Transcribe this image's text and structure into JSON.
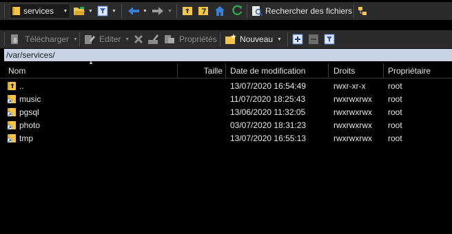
{
  "toolbar1": {
    "folder_combo_value": "services",
    "search_label": "Rechercher des fichiers"
  },
  "toolbar2": {
    "download_label": "Télécharger",
    "edit_label": "Editer",
    "properties_label": "Propriétés",
    "new_label": "Nouveau"
  },
  "path": "/var/services/",
  "columns": {
    "name": "Nom",
    "size": "Taille",
    "modified": "Date de modification",
    "rights": "Droits",
    "owner": "Propriétaire"
  },
  "files": [
    {
      "name": "..",
      "size": "",
      "modified": "13/07/2020 16:54:49",
      "rights": "rwxr-xr-x",
      "owner": "root",
      "icon": "parent-folder-icon"
    },
    {
      "name": "music",
      "size": "",
      "modified": "11/07/2020 18:25:43",
      "rights": "rwxrwxrwx",
      "owner": "root",
      "icon": "folder-link-icon"
    },
    {
      "name": "pgsql",
      "size": "",
      "modified": "13/06/2020 11:32:05",
      "rights": "rwxrwxrwx",
      "owner": "root",
      "icon": "folder-link-icon"
    },
    {
      "name": "photo",
      "size": "",
      "modified": "03/07/2020 18:31:23",
      "rights": "rwxrwxrwx",
      "owner": "root",
      "icon": "folder-link-icon"
    },
    {
      "name": "tmp",
      "size": "",
      "modified": "13/07/2020 16:55:13",
      "rights": "rwxrwxrwx",
      "owner": "root",
      "icon": "folder-link-icon"
    }
  ],
  "colors": {
    "background": "#000000",
    "toolbar": "#2b2b2b",
    "path_bar": "#c9d3e6",
    "folder": "#f3c54a",
    "accent_blue": "#3b7fd6",
    "refresh_green": "#2fa84f"
  }
}
